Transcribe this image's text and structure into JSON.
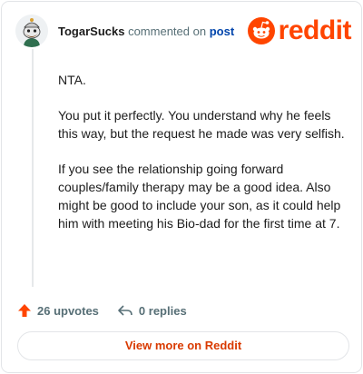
{
  "comment": {
    "username": "TogarSucks",
    "action_text": "commented on",
    "post_link": "post",
    "paragraphs": [
      "NTA.",
      "You put it perfectly. You understand why he feels this way, but the request he made was very selfish.",
      "If you see the relationship going forward couples/family therapy may be a good idea. Also might be good to include your son, as it could help him with meeting his Bio-dad for the first time at 7."
    ]
  },
  "brand": {
    "wordmark": "reddit",
    "color": "#ff4500"
  },
  "actions": {
    "upvotes": "26 upvotes",
    "replies": "0 replies"
  },
  "footer": {
    "view_more": "View more on Reddit"
  },
  "icons": {
    "avatar": "snoo-avatar-icon",
    "logo": "reddit-snoo-icon",
    "upvote": "upvote-arrow-icon",
    "reply": "reply-arrow-icon"
  }
}
